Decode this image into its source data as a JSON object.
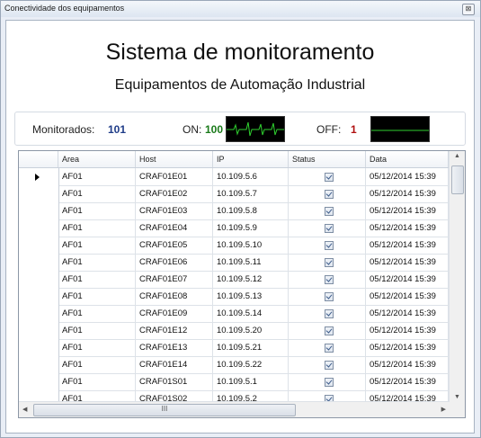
{
  "window": {
    "title": "Conectividade dos equipamentos",
    "close_glyph": "⊠"
  },
  "header": {
    "title": "Sistema de monitoramento",
    "subtitle": "Equipamentos de Automação Industrial"
  },
  "stats": {
    "monitored_label": "Monitorados:",
    "monitored_value": "101",
    "on_label": "ON:",
    "on_value": "100",
    "off_label": "OFF:",
    "off_value": "1",
    "colors": {
      "monitored": "#1f3c88",
      "on": "#1a7a1a",
      "off": "#b01010",
      "scope_trace": "#2fd12f"
    }
  },
  "grid": {
    "columns": [
      "Area",
      "Host",
      "IP",
      "Status",
      "Data"
    ],
    "rows": [
      {
        "area": "AF01",
        "host": "CRAF01E01",
        "ip": "10.109.5.6",
        "status": true,
        "data": "05/12/2014 15:39"
      },
      {
        "area": "AF01",
        "host": "CRAF01E02",
        "ip": "10.109.5.7",
        "status": true,
        "data": "05/12/2014 15:39"
      },
      {
        "area": "AF01",
        "host": "CRAF01E03",
        "ip": "10.109.5.8",
        "status": true,
        "data": "05/12/2014 15:39"
      },
      {
        "area": "AF01",
        "host": "CRAF01E04",
        "ip": "10.109.5.9",
        "status": true,
        "data": "05/12/2014 15:39"
      },
      {
        "area": "AF01",
        "host": "CRAF01E05",
        "ip": "10.109.5.10",
        "status": true,
        "data": "05/12/2014 15:39"
      },
      {
        "area": "AF01",
        "host": "CRAF01E06",
        "ip": "10.109.5.11",
        "status": true,
        "data": "05/12/2014 15:39"
      },
      {
        "area": "AF01",
        "host": "CRAF01E07",
        "ip": "10.109.5.12",
        "status": true,
        "data": "05/12/2014 15:39"
      },
      {
        "area": "AF01",
        "host": "CRAF01E08",
        "ip": "10.109.5.13",
        "status": true,
        "data": "05/12/2014 15:39"
      },
      {
        "area": "AF01",
        "host": "CRAF01E09",
        "ip": "10.109.5.14",
        "status": true,
        "data": "05/12/2014 15:39"
      },
      {
        "area": "AF01",
        "host": "CRAF01E12",
        "ip": "10.109.5.20",
        "status": true,
        "data": "05/12/2014 15:39"
      },
      {
        "area": "AF01",
        "host": "CRAF01E13",
        "ip": "10.109.5.21",
        "status": true,
        "data": "05/12/2014 15:39"
      },
      {
        "area": "AF01",
        "host": "CRAF01E14",
        "ip": "10.109.5.22",
        "status": true,
        "data": "05/12/2014 15:39"
      },
      {
        "area": "AF01",
        "host": "CRAF01S01",
        "ip": "10.109.5.1",
        "status": true,
        "data": "05/12/2014 15:39"
      },
      {
        "area": "AF01",
        "host": "CRAF01S02",
        "ip": "10.109.5.2",
        "status": true,
        "data": "05/12/2014 15:39"
      }
    ],
    "scrollbar_glyph": "III",
    "selected_row": 0
  },
  "icons": {
    "close": "close-icon",
    "row_pointer": "row-pointer-icon",
    "status_check": "checkbox-checked-icon",
    "scroll_up": "scroll-up-icon",
    "scroll_down": "scroll-down-icon",
    "scroll_left": "scroll-left-icon",
    "scroll_right": "scroll-right-icon",
    "on_scope": "heartbeat-scope-icon",
    "off_scope": "flatline-scope-icon"
  }
}
